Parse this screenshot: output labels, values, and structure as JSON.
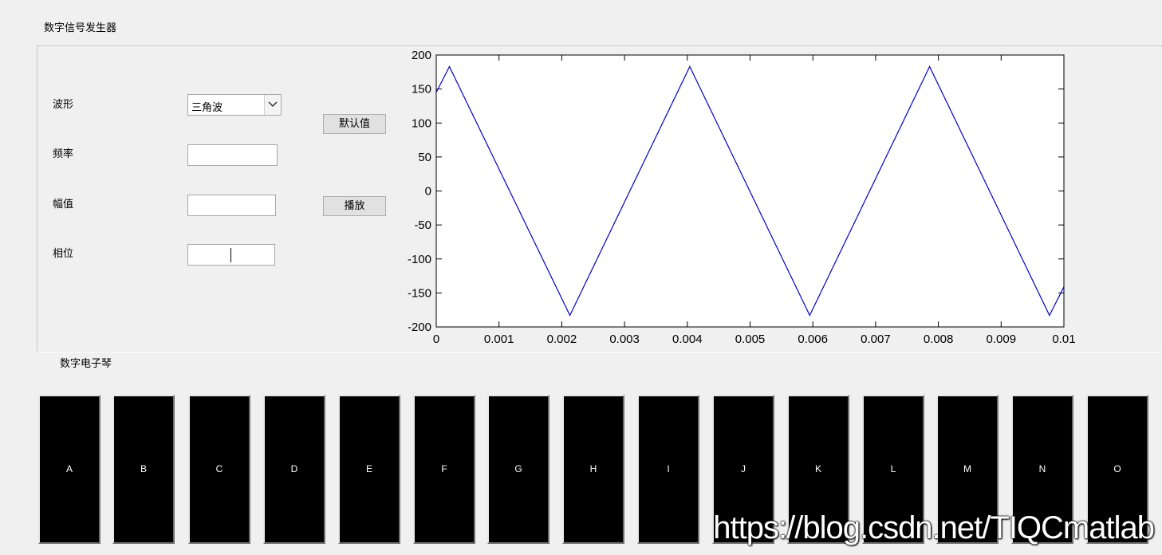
{
  "panel_title": "数字信号发生器",
  "controls": {
    "waveform_label": "波形",
    "waveform_value": "三角波",
    "frequency_label": "频率",
    "frequency_value": "",
    "amplitude_label": "幅值",
    "amplitude_value": "",
    "phase_label": "相位",
    "phase_value": "",
    "default_button": "默认值",
    "play_button": "播放"
  },
  "keyboard": {
    "title": "数字电子琴",
    "keys": [
      "A",
      "B",
      "C",
      "D",
      "E",
      "F",
      "G",
      "H",
      "I",
      "J",
      "K",
      "L",
      "M",
      "N",
      "O"
    ]
  },
  "watermark": "https://blog.csdn.net/TIQCmatlab",
  "chart_data": {
    "type": "line",
    "x": [
      0,
      0.00021,
      0.00213,
      0.00404,
      0.00595,
      0.00786,
      0.00977,
      0.01
    ],
    "series": [
      {
        "values": [
          145,
          183,
          -183,
          183,
          -183,
          183,
          -183,
          -141
        ],
        "color": "#0000cc"
      }
    ],
    "xlim": [
      0,
      0.01
    ],
    "ylim": [
      -200,
      200
    ],
    "xticks": [
      0,
      0.001,
      0.002,
      0.003,
      0.004,
      0.005,
      0.006,
      0.007,
      0.008,
      0.009,
      0.01
    ],
    "xtick_labels": [
      "0",
      "0.001",
      "0.002",
      "0.003",
      "0.004",
      "0.005",
      "0.006",
      "0.007",
      "0.008",
      "0.009",
      "0.01"
    ],
    "yticks": [
      200,
      150,
      100,
      50,
      0,
      -50,
      -100,
      -150,
      -200
    ],
    "ytick_labels": [
      "200",
      "150",
      "100",
      "50",
      "0",
      "-50",
      "-100",
      "-150",
      "-200"
    ],
    "grid": false
  }
}
